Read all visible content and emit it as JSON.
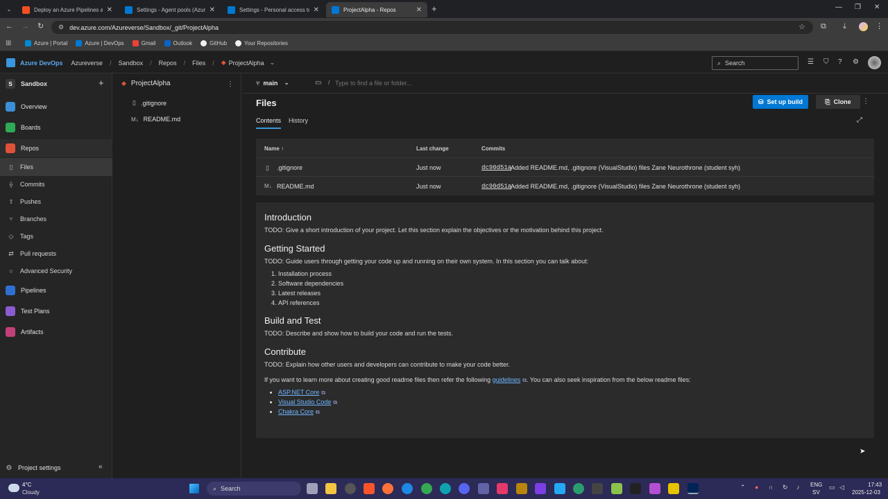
{
  "browser": {
    "tabs": [
      {
        "title": "Deploy an Azure Pipelines age",
        "color": "#f25022"
      },
      {
        "title": "Settings - Agent pools (Azureve",
        "color": "#0078d4"
      },
      {
        "title": "Settings - Personal access token",
        "color": "#0078d4"
      },
      {
        "title": "ProjectAlpha - Repos",
        "color": "#0078d4"
      }
    ],
    "url": "dev.azure.com/Azureverse/Sandbox/_git/ProjectAlpha",
    "bookmarks": [
      "Azure | Portal",
      "Azure | DevOps",
      "Gmail",
      "Outlook",
      "GitHub",
      "Your Repositories"
    ]
  },
  "header": {
    "brand": "Azure DevOps",
    "breadcrumbs": [
      "Azureverse",
      "Sandbox",
      "Repos",
      "Files",
      "ProjectAlpha"
    ],
    "search_placeholder": "Search"
  },
  "sidebar": {
    "project": "Sandbox",
    "project_initial": "S",
    "items": [
      {
        "label": "Overview",
        "color": "#3a8fd6"
      },
      {
        "label": "Boards",
        "color": "#2eaa56"
      },
      {
        "label": "Repos",
        "color": "#e05238"
      }
    ],
    "repo_subitems": [
      "Files",
      "Commits",
      "Pushes",
      "Branches",
      "Tags",
      "Pull requests",
      "Advanced Security"
    ],
    "items_after": [
      {
        "label": "Pipelines",
        "color": "#2f6fd0"
      },
      {
        "label": "Test Plans",
        "color": "#8a5bd1"
      },
      {
        "label": "Artifacts",
        "color": "#c2407a"
      }
    ],
    "settings_label": "Project settings"
  },
  "tree": {
    "repo_name": "ProjectAlpha",
    "files": [
      {
        "icon": "▯",
        "name": ".gitignore"
      },
      {
        "icon": "M↓",
        "name": "README.md"
      }
    ]
  },
  "main": {
    "branch": "main",
    "path_placeholder": "Type to find a file or folder...",
    "title": "Files",
    "tabs": [
      "Contents",
      "History"
    ],
    "setup_build": "Set up build",
    "clone": "Clone",
    "columns": [
      "Name ↑",
      "Last change",
      "Commits"
    ],
    "rows": [
      {
        "icon": "▯",
        "name": ".gitignore",
        "change": "Just now",
        "hash": "dc90d51a",
        "message": "Added README.md, .gitignore (VisualStudio) files Zane Neurothrone (student syh)"
      },
      {
        "icon": "M↓",
        "name": "README.md",
        "change": "Just now",
        "hash": "dc90d51a",
        "message": "Added README.md, .gitignore (VisualStudio) files Zane Neurothrone (student syh)"
      }
    ]
  },
  "readme": {
    "intro_h": "Introduction",
    "intro_p": "TODO: Give a short introduction of your project. Let this section explain the objectives or the motivation behind this project.",
    "gs_h": "Getting Started",
    "gs_p": "TODO: Guide users through getting your code up and running on their own system. In this section you can talk about:",
    "gs_list": [
      "Installation process",
      "Software dependencies",
      "Latest releases",
      "API references"
    ],
    "bt_h": "Build and Test",
    "bt_p": "TODO: Describe and show how to build your code and run the tests.",
    "co_h": "Contribute",
    "co_p": "TODO: Explain how other users and developers can contribute to make your code better.",
    "co_p2_a": "If you want to learn more about creating good readme files then refer the following",
    "co_link": "guidelines",
    "co_p2_b": ". You can also seek inspiration from the below readme files:",
    "links": [
      "ASP.NET Core",
      "Visual Studio Code",
      "Chakra Core"
    ]
  },
  "taskbar": {
    "temp": "4°C",
    "weather": "Cloudy",
    "search": "Search",
    "lang1": "ENG",
    "lang2": "SV",
    "time": "17:43",
    "date": "2025-12-03"
  }
}
